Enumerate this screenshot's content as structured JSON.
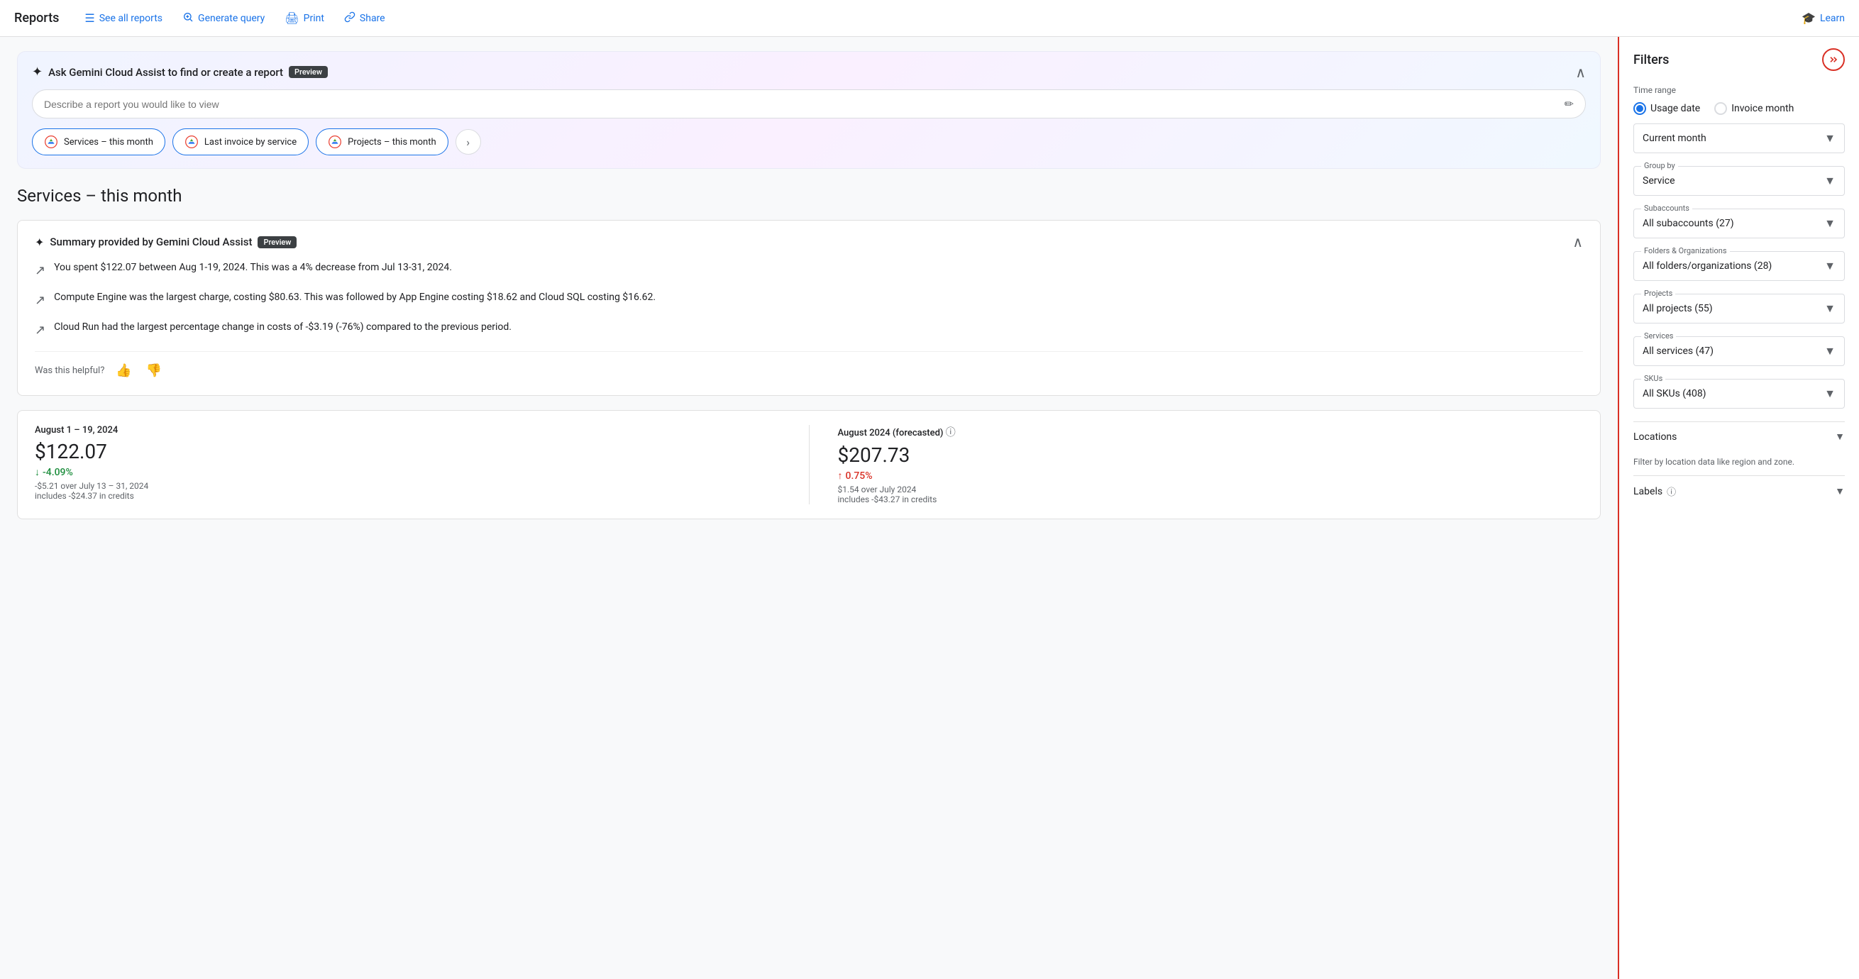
{
  "nav": {
    "brand": "Reports",
    "links": [
      {
        "id": "see-all",
        "icon": "☰",
        "label": "See all reports"
      },
      {
        "id": "generate",
        "icon": "🔍",
        "label": "Generate query"
      },
      {
        "id": "print",
        "icon": "🖨",
        "label": "Print"
      },
      {
        "id": "share",
        "icon": "🔗",
        "label": "Share"
      },
      {
        "id": "learn",
        "icon": "🎓",
        "label": "Learn"
      }
    ]
  },
  "gemini": {
    "title": "Ask Gemini Cloud Assist to find or create a report",
    "preview_badge": "Preview",
    "search_placeholder": "Describe a report you would like to view",
    "chips": [
      {
        "label": "Services – this month"
      },
      {
        "label": "Last invoice by service"
      },
      {
        "label": "Projects – this month"
      }
    ]
  },
  "page_title": "Services – this month",
  "summary": {
    "title": "Summary provided by Gemini Cloud Assist",
    "preview_badge": "Preview",
    "items": [
      "You spent $122.07 between Aug 1-19, 2024. This was a 4% decrease from Jul 13-31, 2024.",
      "Compute Engine was the largest charge, costing $80.63. This was followed by App Engine costing $18.62 and Cloud SQL costing $16.62.",
      "Cloud Run had the largest percentage change in costs of -$3.19 (-76%) compared to the previous period."
    ],
    "feedback_label": "Was this helpful?"
  },
  "stats": {
    "current": {
      "period": "August 1 – 19, 2024",
      "amount": "$122.07",
      "change_pct": "-4.09%",
      "change_type": "down",
      "change_label": "-$5.21 over July 13 – 31, 2024",
      "sub": "includes -$24.37 in credits"
    },
    "forecasted": {
      "period": "August 2024 (forecasted)",
      "amount": "$207.73",
      "change_pct": "0.75%",
      "change_type": "up",
      "change_label": "$1.54 over July 2024",
      "sub": "includes -$43.27 in credits",
      "has_info": true
    }
  },
  "filters": {
    "title": "Filters",
    "time_range_label": "Time range",
    "radio_options": [
      {
        "label": "Usage date",
        "selected": true
      },
      {
        "label": "Invoice month",
        "selected": false
      }
    ],
    "current_month_label": "Current month",
    "group_by_label": "Group by",
    "group_by_value": "Service",
    "subaccounts_label": "Subaccounts",
    "subaccounts_value": "All subaccounts (27)",
    "folders_label": "Folders & Organizations",
    "folders_value": "All folders/organizations (28)",
    "projects_label": "Projects",
    "projects_value": "All projects (55)",
    "services_label": "Services",
    "services_value": "All services (47)",
    "skus_label": "SKUs",
    "skus_value": "All SKUs (408)",
    "locations_label": "Locations",
    "locations_sub": "Filter by location data like region and zone.",
    "labels_label": "Labels"
  }
}
